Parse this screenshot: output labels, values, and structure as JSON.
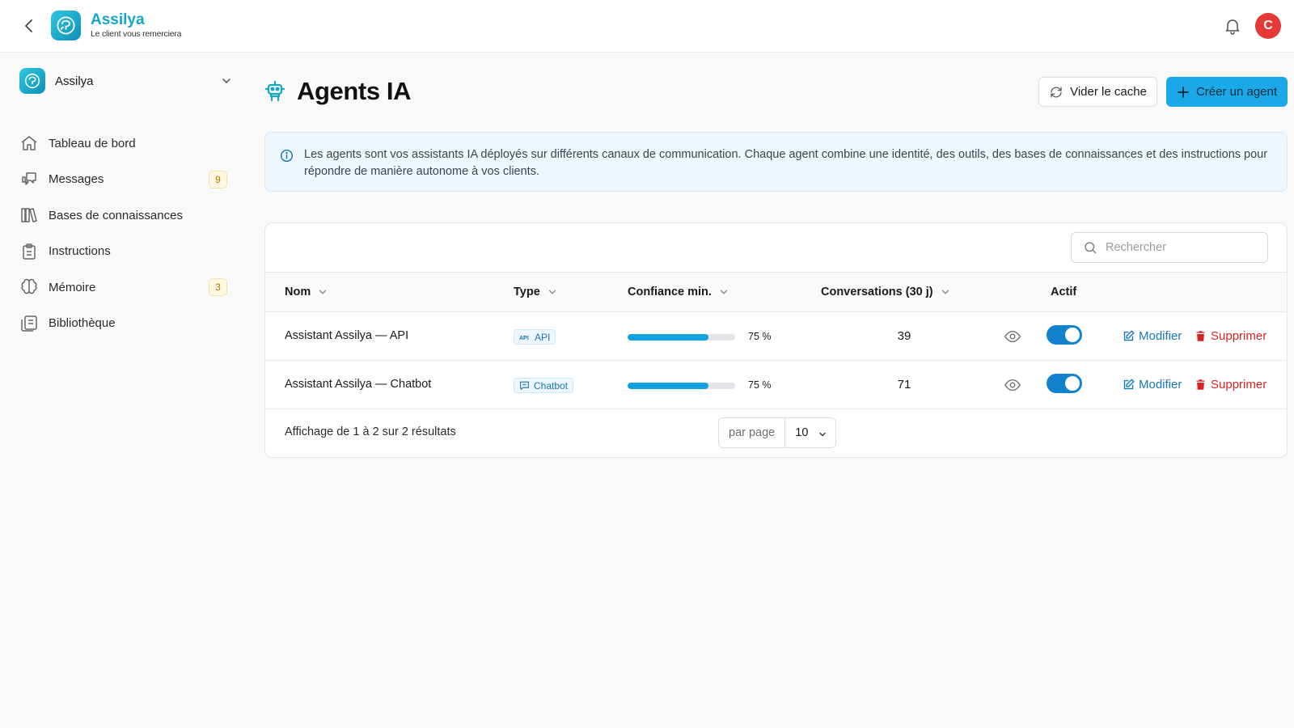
{
  "brand": {
    "name": "Assilya",
    "tagline": "Le client vous remerciera"
  },
  "user": {
    "avatar_initial": "C",
    "avatar_color": "#e53935"
  },
  "workspace": {
    "name": "Assilya"
  },
  "sidebar": {
    "items": [
      {
        "label": "Tableau de bord",
        "icon": "home-icon",
        "badge": ""
      },
      {
        "label": "Messages",
        "icon": "messages-icon",
        "badge": "9"
      },
      {
        "label": "Bases de connaissances",
        "icon": "books-icon",
        "badge": ""
      },
      {
        "label": "Instructions",
        "icon": "clipboard-icon",
        "badge": ""
      },
      {
        "label": "Mémoire",
        "icon": "brain-icon",
        "badge": "3"
      },
      {
        "label": "Bibliothèque",
        "icon": "library-icon",
        "badge": ""
      }
    ]
  },
  "page": {
    "title": "Agents IA",
    "clear_cache_label": "Vider le cache",
    "create_label": "Créer un agent",
    "info_text": "Les agents sont vos assistants IA déployés sur différents canaux de communication. Chaque agent combine une identité, des outils, des bases de connaissances et des instructions pour répondre de manière autonome à vos clients."
  },
  "search": {
    "placeholder": "Rechercher"
  },
  "table": {
    "columns": {
      "name": "Nom",
      "type": "Type",
      "confidence": "Confiance min.",
      "conversations": "Conversations (30 j)",
      "active": "Actif"
    },
    "rows": [
      {
        "name": "Assistant Assilya — API",
        "type": "API",
        "type_icon": "api-icon",
        "confidence_pct": 75,
        "confidence_label": "75 %",
        "conversations": "39",
        "active": true,
        "edit_label": "Modifier",
        "delete_label": "Supprimer"
      },
      {
        "name": "Assistant Assilya — Chatbot",
        "type": "Chatbot",
        "type_icon": "chat-icon",
        "confidence_pct": 75,
        "confidence_label": "75 %",
        "conversations": "71",
        "active": true,
        "edit_label": "Modifier",
        "delete_label": "Supprimer"
      }
    ],
    "footer_text": "Affichage de 1 à 2 sur 2 résultats",
    "per_page_label": "par page",
    "per_page_value": "10"
  },
  "colors": {
    "accent": "#1aa8e8",
    "brand": "#12a6c8",
    "danger": "#d32424",
    "link": "#1677b5"
  }
}
